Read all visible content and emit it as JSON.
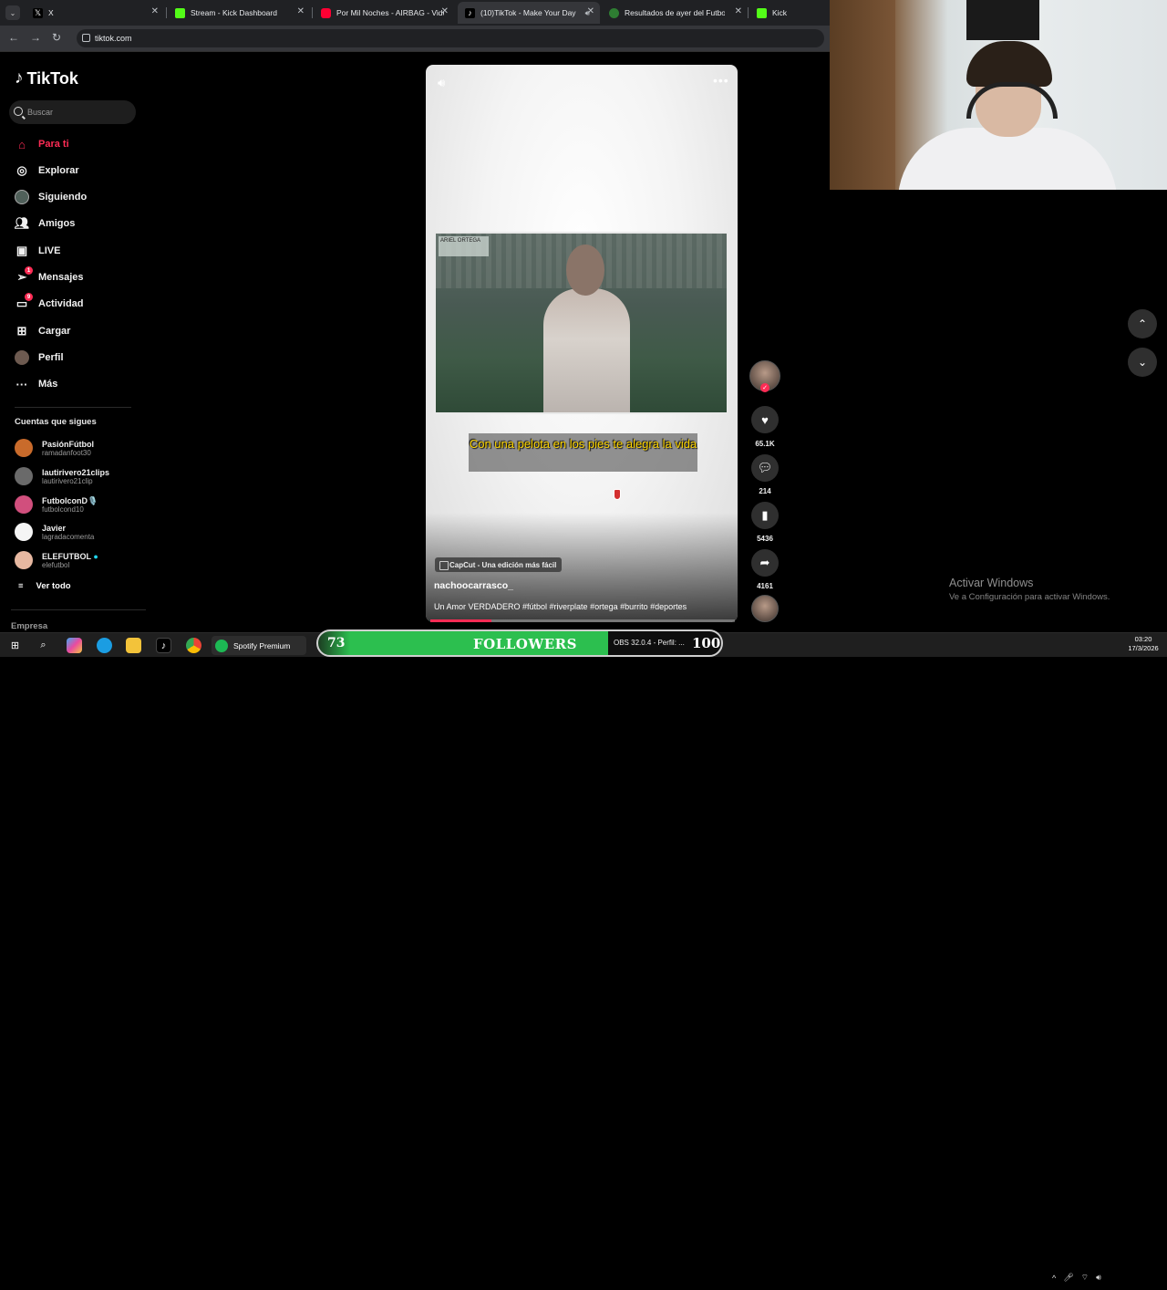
{
  "browser": {
    "tabs": [
      {
        "title": "X",
        "icon": "x-logo",
        "active": false
      },
      {
        "title": "Stream - Kick Dashboard",
        "icon": "kick-logo",
        "active": false
      },
      {
        "title": "Por Mil Noches - AIRBAG - Vide",
        "icon": "youtube-logo",
        "active": false
      },
      {
        "title": "(10)TikTok - Make Your Day",
        "icon": "tiktok-logo",
        "active": true
      },
      {
        "title": "Resultados de ayer del Futbol A",
        "icon": "globe-icon",
        "active": false
      },
      {
        "title": "Kick",
        "icon": "kick-logo",
        "active": false
      }
    ],
    "url": "tiktok.com"
  },
  "sidebar": {
    "logo": "TikTok",
    "search_placeholder": "Buscar",
    "nav": [
      {
        "label": "Para ti",
        "icon": "home-icon",
        "active": true
      },
      {
        "label": "Explorar",
        "icon": "compass-icon"
      },
      {
        "label": "Siguiendo",
        "icon": "following-avatar-icon"
      },
      {
        "label": "Amigos",
        "icon": "friends-icon"
      },
      {
        "label": "LIVE",
        "icon": "live-icon"
      },
      {
        "label": "Mensajes",
        "icon": "messages-icon",
        "badge": "1"
      },
      {
        "label": "Actividad",
        "icon": "activity-icon",
        "badge": "9"
      },
      {
        "label": "Cargar",
        "icon": "upload-icon"
      },
      {
        "label": "Perfil",
        "icon": "profile-avatar-icon"
      },
      {
        "label": "Más",
        "icon": "more-icon"
      }
    ],
    "following_title": "Cuentas que sigues",
    "following": [
      {
        "name": "PasiónFútbol",
        "handle": "ramadanfoot30",
        "color": "#c96b2b"
      },
      {
        "name": "lautirivero21clips",
        "handle": "lautirivero21clip",
        "color": "#6a6a6a"
      },
      {
        "name": "FutbolconD🎙️",
        "handle": "futbolcond10",
        "color": "#d14f7d"
      },
      {
        "name": "Javier",
        "handle": "lagradacomenta",
        "color": "#f5f5f5"
      },
      {
        "name": "ELEFUTBOL",
        "handle": "elefutbol",
        "color": "#e7b8a1",
        "verified": true
      }
    ],
    "see_all": "Ver todo",
    "footer": "Empresa"
  },
  "video": {
    "caption": "Con una pelota en los pies te alegra la vida",
    "clip_tag": "ARIEL ORTEGA",
    "capcut": "CapCut - Una edición más fácil",
    "author": "nachoocarrasco_",
    "description": "Un Amor VERDADERO #fútbol #riverplate #ortega #burrito #deportes",
    "progress": 0.2,
    "likes": "65.1K",
    "comments": "214",
    "saves": "5436",
    "shares": "4161"
  },
  "overlay": {
    "activate_title": "Activar Windows",
    "activate_sub": "Ve a Configuración para activar Windows."
  },
  "taskbar": {
    "spotify_label": "Spotify Premium",
    "followers_current": "73",
    "followers_label": "FOLLOWERS",
    "followers_goal": "100",
    "obs_label": "OBS 32.0.4 - Perfil: ...",
    "time": "03:20",
    "date": "17/3/2026"
  }
}
